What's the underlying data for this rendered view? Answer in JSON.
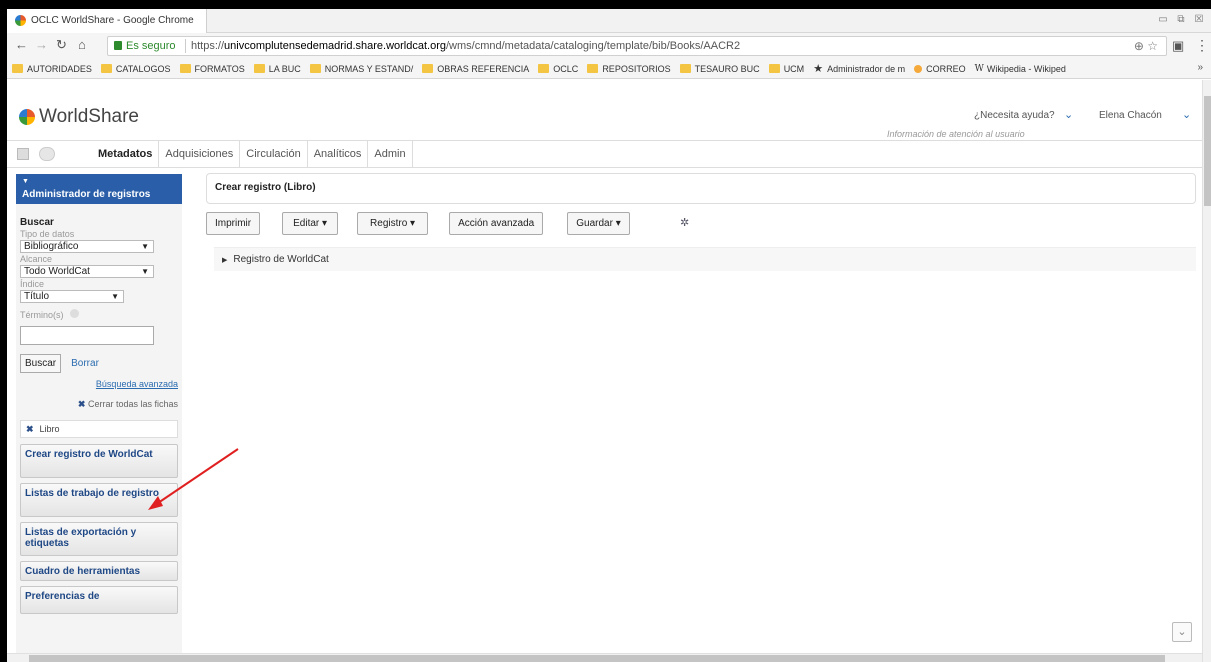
{
  "browser": {
    "window_title": "OCLC WorldShare - Google Chrome",
    "secure_label": "Es seguro",
    "url_prefix": "https://",
    "url_domain": "univcomplutensedemadrid.share.worldcat.org",
    "url_path": "/wms/cmnd/metadata/cataloging/template/bib/Books/AACR2",
    "bookmarks": [
      {
        "label": "AUTORIDADES",
        "icon": "folder-icon"
      },
      {
        "label": "CATALOGOS",
        "icon": "folder-icon"
      },
      {
        "label": "FORMATOS",
        "icon": "folder-icon"
      },
      {
        "label": "LA BUC",
        "icon": "folder-icon"
      },
      {
        "label": "NORMAS Y ESTAND/",
        "icon": "folder-icon"
      },
      {
        "label": "OBRAS REFERENCIA",
        "icon": "folder-icon"
      },
      {
        "label": "OCLC",
        "icon": "folder-icon"
      },
      {
        "label": "REPOSITORIOS",
        "icon": "folder-icon"
      },
      {
        "label": "TESAURO BUC",
        "icon": "folder-icon"
      },
      {
        "label": "UCM",
        "icon": "folder-icon"
      },
      {
        "label": "Administrador de m",
        "icon": "star-icon"
      },
      {
        "label": "CORREO",
        "icon": "mail-icon"
      },
      {
        "label": "Wikipedia - Wikiped",
        "icon": "wikipedia-icon"
      }
    ],
    "bookmarks_more": "»"
  },
  "header": {
    "logo_text": "WorldShare",
    "help_label": "¿Necesita ayuda?",
    "help_sub": "Información de atención al usuario",
    "user_name": "Elena Chacón"
  },
  "modules": [
    "Metadatos",
    "Adquisiciones",
    "Circulación",
    "Analíticos",
    "Admin"
  ],
  "sidebar": {
    "panel_title": "Administrador de registros",
    "search_title": "Buscar",
    "datatype_label": "Tipo de datos",
    "datatype_value": "Bibliográfico",
    "scope_label": "Alcance",
    "scope_value": "Todo WorldCat",
    "index_label": "Índice",
    "index_value": "Título",
    "terms_label": "Término(s)",
    "search_button": "Buscar",
    "clear_link": "Borrar",
    "advanced_link": "Búsqueda avanzada",
    "close_all": "Cerrar todas las fichas",
    "filter_chip": "Libro",
    "nav_buttons": [
      "Crear registro de WorldCat",
      "Listas de trabajo de registro",
      "Listas de exportación y etiquetas",
      "Cuadro de herramientas",
      "Preferencias de"
    ]
  },
  "main": {
    "record_title": "Crear registro (Libro)",
    "toolbar": {
      "print": "Imprimir",
      "edit": "Editar ▾",
      "record": "Registro ▾",
      "advanced_action": "Acción avanzada",
      "save": "Guardar ▾"
    },
    "worldcat_record": "Registro de WorldCat"
  },
  "colors": {
    "panel_blue": "#2a5ea8",
    "link_blue": "#2b6cb0",
    "annotation_red": "#e02020"
  }
}
